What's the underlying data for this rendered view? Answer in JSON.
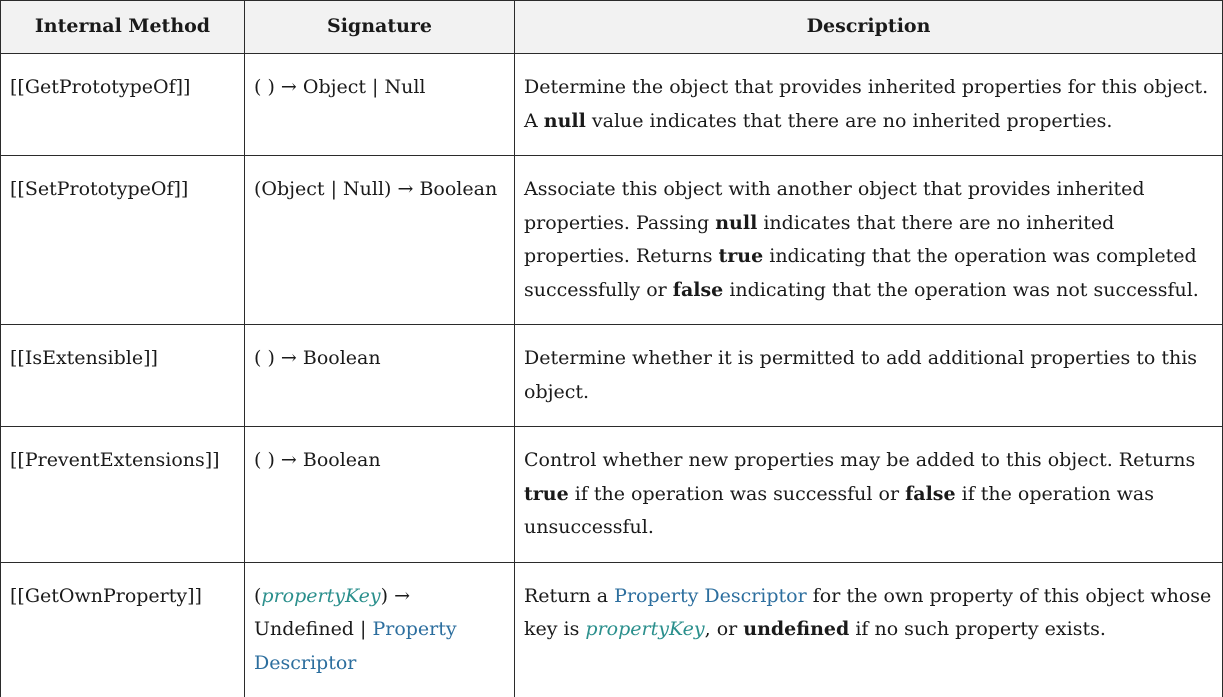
{
  "headers": {
    "method": "Internal Method",
    "signature": "Signature",
    "description": "Description"
  },
  "rows": [
    {
      "method": "[[GetPrototypeOf]]",
      "signature": "( ) → Object | Null",
      "desc": {
        "p1": "Determine the object that provides inherited properties for this object. A ",
        "b1": "null",
        "p2": " value indicates that there are no inherited properties."
      }
    },
    {
      "method": "[[SetPrototypeOf]]",
      "signature": "(Object | Null) → Boolean",
      "desc": {
        "p1": "Associate this object with another object that provides inherited properties. Passing ",
        "b1": "null",
        "p2": " indicates that there are no inherited properties. Returns ",
        "b2": "true",
        "p3": " indicating that the operation was completed successfully or ",
        "b3": "false",
        "p4": " indicating that the operation was not successful."
      }
    },
    {
      "method": "[[IsExtensible]]",
      "signature": "( ) → Boolean",
      "desc": {
        "p1": "Determine whether it is permitted to add additional properties to this object."
      }
    },
    {
      "method": "[[PreventExtensions]]",
      "signature": "( ) → Boolean",
      "desc": {
        "p1": "Control whether new properties may be added to this object. Returns ",
        "b1": "true",
        "p2": " if the operation was successful or ",
        "b2": "false",
        "p3": " if the operation was unsuccessful."
      }
    },
    {
      "method": "[[GetOwnProperty]]",
      "signature": {
        "open": "(",
        "var": "propertyKey",
        "mid": ") → Undefined | ",
        "link": "Property Descriptor"
      },
      "desc": {
        "p1": "Return a ",
        "link": "Property Descriptor",
        "p2": " for the own property of this object whose key is ",
        "var": "propertyKey",
        "p3": ", or ",
        "b1": "undefined",
        "p4": " if no such property exists."
      }
    }
  ],
  "colors": {
    "link": "#2c6e9e",
    "variable": "#2a8f8c",
    "header_bg": "#f2f2f2",
    "border": "#2b2b2b"
  }
}
